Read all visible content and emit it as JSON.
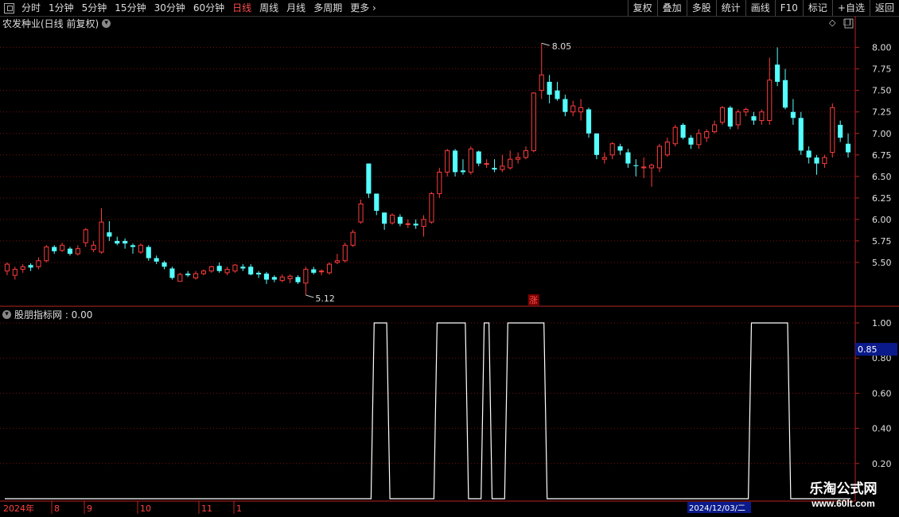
{
  "toolbar": {
    "periods": [
      "分时",
      "1分钟",
      "5分钟",
      "15分钟",
      "30分钟",
      "60分钟",
      "日线",
      "周线",
      "月线",
      "多周期",
      "更多"
    ],
    "active": "日线",
    "more_arrow": "›",
    "right_buttons": [
      "复权",
      "叠加",
      "多股",
      "统计",
      "画线",
      "F10",
      "标记",
      "+自选",
      "返回"
    ]
  },
  "main_title": "农发种业(日线 前复权)",
  "indicator_title": "股朋指标网 : 0.00",
  "price_axis": {
    "ticks": [
      "8.00",
      "7.75",
      "7.50",
      "7.25",
      "7.00",
      "6.75",
      "6.50",
      "6.25",
      "6.00",
      "5.75",
      "5.50"
    ],
    "min": 5.0,
    "max": 8.2
  },
  "indicator_axis": {
    "ticks": [
      "1.00",
      "0.80",
      "0.60",
      "0.40",
      "0.20"
    ],
    "current": "0.85"
  },
  "annotations": {
    "high": "8.05",
    "low": "5.12",
    "zhang": "涨"
  },
  "time_axis": {
    "labels": [
      "2024年",
      "8",
      "9",
      "10",
      "11",
      "1"
    ],
    "cursor_date": "2024/12/03/二"
  },
  "logo": {
    "cn": "乐淘公式网",
    "url": "www.60lt.com"
  },
  "status_text": "...",
  "colors": {
    "up": "#ff3c3c",
    "down": "#54ffff",
    "grid": "#7a1010",
    "line": "#ffffff"
  },
  "chart_data": {
    "type": "candlestick",
    "title": "农发种业(日线 前复权)",
    "candles": [
      [
        5.4,
        5.48,
        5.5,
        5.35
      ],
      [
        5.35,
        5.42,
        5.45,
        5.3
      ],
      [
        5.42,
        5.45,
        5.48,
        5.38
      ],
      [
        5.47,
        5.44,
        5.49,
        5.4
      ],
      [
        5.45,
        5.52,
        5.56,
        5.42
      ],
      [
        5.52,
        5.68,
        5.7,
        5.5
      ],
      [
        5.68,
        5.63,
        5.7,
        5.6
      ],
      [
        5.64,
        5.7,
        5.73,
        5.62
      ],
      [
        5.66,
        5.6,
        5.68,
        5.58
      ],
      [
        5.6,
        5.66,
        5.7,
        5.58
      ],
      [
        5.73,
        5.88,
        5.9,
        5.68
      ],
      [
        5.65,
        5.7,
        5.75,
        5.62
      ],
      [
        5.62,
        5.97,
        6.13,
        5.6
      ],
      [
        5.85,
        5.8,
        5.98,
        5.75
      ],
      [
        5.75,
        5.72,
        5.8,
        5.7
      ],
      [
        5.75,
        5.72,
        5.78,
        5.66
      ],
      [
        5.7,
        5.68,
        5.72,
        5.6
      ],
      [
        5.62,
        5.7,
        5.72,
        5.6
      ],
      [
        5.68,
        5.55,
        5.7,
        5.52
      ],
      [
        5.55,
        5.51,
        5.58,
        5.48
      ],
      [
        5.5,
        5.45,
        5.52,
        5.42
      ],
      [
        5.43,
        5.32,
        5.45,
        5.3
      ],
      [
        5.28,
        5.36,
        5.38,
        5.28
      ],
      [
        5.37,
        5.35,
        5.4,
        5.33
      ],
      [
        5.32,
        5.37,
        5.4,
        5.3
      ],
      [
        5.37,
        5.4,
        5.42,
        5.35
      ],
      [
        5.4,
        5.45,
        5.46,
        5.38
      ],
      [
        5.46,
        5.4,
        5.5,
        5.38
      ],
      [
        5.38,
        5.42,
        5.45,
        5.35
      ],
      [
        5.4,
        5.47,
        5.48,
        5.38
      ],
      [
        5.45,
        5.43,
        5.48,
        5.4
      ],
      [
        5.45,
        5.36,
        5.48,
        5.35
      ],
      [
        5.38,
        5.36,
        5.4,
        5.32
      ],
      [
        5.37,
        5.3,
        5.39,
        5.25
      ],
      [
        5.33,
        5.3,
        5.35,
        5.27
      ],
      [
        5.29,
        5.33,
        5.36,
        5.27
      ],
      [
        5.31,
        5.34,
        5.36,
        5.26
      ],
      [
        5.33,
        5.27,
        5.35,
        5.25
      ],
      [
        5.26,
        5.42,
        5.45,
        5.12
      ],
      [
        5.42,
        5.38,
        5.45,
        5.36
      ],
      [
        5.4,
        5.4,
        5.42,
        5.35
      ],
      [
        5.38,
        5.48,
        5.5,
        5.36
      ],
      [
        5.5,
        5.52,
        5.6,
        5.48
      ],
      [
        5.52,
        5.7,
        5.73,
        5.5
      ],
      [
        5.7,
        5.85,
        5.88,
        5.68
      ],
      [
        5.97,
        6.18,
        6.23,
        5.95
      ],
      [
        6.65,
        6.3,
        6.65,
        6.25
      ],
      [
        6.3,
        6.1,
        6.3,
        6.05
      ],
      [
        6.08,
        5.95,
        6.08,
        5.88
      ],
      [
        5.96,
        6.05,
        6.07,
        5.94
      ],
      [
        6.03,
        5.95,
        6.06,
        5.92
      ],
      [
        5.95,
        5.95,
        6.0,
        5.9
      ],
      [
        5.95,
        5.93,
        6.0,
        5.89
      ],
      [
        5.92,
        6.0,
        6.05,
        5.8
      ],
      [
        5.97,
        6.3,
        6.32,
        5.95
      ],
      [
        6.3,
        6.55,
        6.6,
        6.25
      ],
      [
        6.55,
        6.8,
        6.82,
        6.5
      ],
      [
        6.8,
        6.55,
        6.82,
        6.5
      ],
      [
        6.57,
        6.55,
        6.7,
        6.52
      ],
      [
        6.55,
        6.82,
        6.85,
        6.52
      ],
      [
        6.79,
        6.65,
        6.8,
        6.62
      ],
      [
        6.64,
        6.65,
        6.7,
        6.6
      ],
      [
        6.6,
        6.58,
        6.7,
        6.55
      ],
      [
        6.58,
        6.62,
        6.75,
        6.55
      ],
      [
        6.6,
        6.7,
        6.8,
        6.58
      ],
      [
        6.7,
        6.72,
        6.78,
        6.65
      ],
      [
        6.72,
        6.8,
        6.85,
        6.7
      ],
      [
        6.8,
        7.47,
        7.48,
        6.78
      ],
      [
        7.5,
        7.68,
        8.05,
        7.4
      ],
      [
        7.6,
        7.45,
        7.68,
        7.35
      ],
      [
        7.5,
        7.4,
        7.6,
        7.38
      ],
      [
        7.4,
        7.25,
        7.45,
        7.2
      ],
      [
        7.25,
        7.32,
        7.38,
        7.2
      ],
      [
        7.25,
        7.3,
        7.4,
        7.15
      ],
      [
        7.28,
        7.0,
        7.3,
        6.95
      ],
      [
        7.0,
        6.75,
        7.0,
        6.7
      ],
      [
        6.7,
        6.72,
        6.78,
        6.65
      ],
      [
        6.75,
        6.88,
        6.9,
        6.7
      ],
      [
        6.85,
        6.8,
        6.88,
        6.75
      ],
      [
        6.78,
        6.65,
        6.82,
        6.6
      ],
      [
        6.63,
        6.62,
        6.7,
        6.5
      ],
      [
        6.6,
        6.61,
        6.72,
        6.48
      ],
      [
        6.6,
        6.63,
        6.65,
        6.38
      ],
      [
        6.6,
        6.85,
        6.88,
        6.55
      ],
      [
        6.75,
        6.9,
        6.95,
        6.73
      ],
      [
        6.88,
        7.07,
        7.1,
        6.85
      ],
      [
        7.1,
        6.95,
        7.12,
        6.93
      ],
      [
        6.95,
        6.87,
        6.98,
        6.82
      ],
      [
        6.87,
        7.0,
        7.05,
        6.82
      ],
      [
        6.95,
        7.02,
        7.05,
        6.9
      ],
      [
        7.02,
        7.1,
        7.15,
        7.0
      ],
      [
        7.13,
        7.3,
        7.32,
        7.1
      ],
      [
        7.3,
        7.08,
        7.32,
        7.05
      ],
      [
        7.1,
        7.25,
        7.28,
        7.05
      ],
      [
        7.25,
        7.28,
        7.3,
        7.2
      ],
      [
        7.2,
        7.15,
        7.25,
        7.1
      ],
      [
        7.15,
        7.25,
        7.28,
        7.1
      ],
      [
        7.15,
        7.62,
        7.88,
        7.1
      ],
      [
        7.8,
        7.6,
        8.0,
        7.55
      ],
      [
        7.62,
        7.3,
        7.75,
        7.28
      ],
      [
        7.25,
        7.18,
        7.4,
        7.1
      ],
      [
        7.18,
        6.8,
        7.25,
        6.75
      ],
      [
        6.8,
        6.72,
        6.85,
        6.65
      ],
      [
        6.72,
        6.65,
        6.75,
        6.52
      ],
      [
        6.65,
        6.72,
        6.75,
        6.6
      ],
      [
        6.78,
        7.3,
        7.35,
        6.72
      ],
      [
        7.1,
        6.95,
        7.15,
        6.9
      ],
      [
        6.88,
        6.78,
        7.0,
        6.72
      ]
    ],
    "indicator": [
      0,
      0,
      0,
      0,
      0,
      0,
      0,
      0,
      0,
      0,
      0,
      0,
      0,
      0,
      0,
      0,
      0,
      0,
      0,
      0,
      0,
      0,
      0,
      0,
      0,
      0,
      0,
      0,
      0,
      0,
      0,
      0,
      0,
      0,
      0,
      0,
      0,
      0,
      0,
      0,
      0,
      0,
      0,
      0,
      0,
      0,
      0,
      1,
      1,
      0,
      0,
      0,
      0,
      0,
      0,
      1,
      1,
      1,
      1,
      0,
      0,
      1,
      0,
      0,
      1,
      1,
      1,
      1,
      1,
      0,
      0,
      0,
      0,
      0,
      0,
      0,
      0,
      0,
      0,
      0,
      0,
      0,
      0,
      0,
      0,
      0,
      0,
      0,
      0,
      0,
      0,
      0,
      0,
      0,
      0,
      1,
      1,
      1,
      1,
      1,
      0,
      0,
      0,
      0,
      0,
      0,
      0,
      0
    ]
  }
}
